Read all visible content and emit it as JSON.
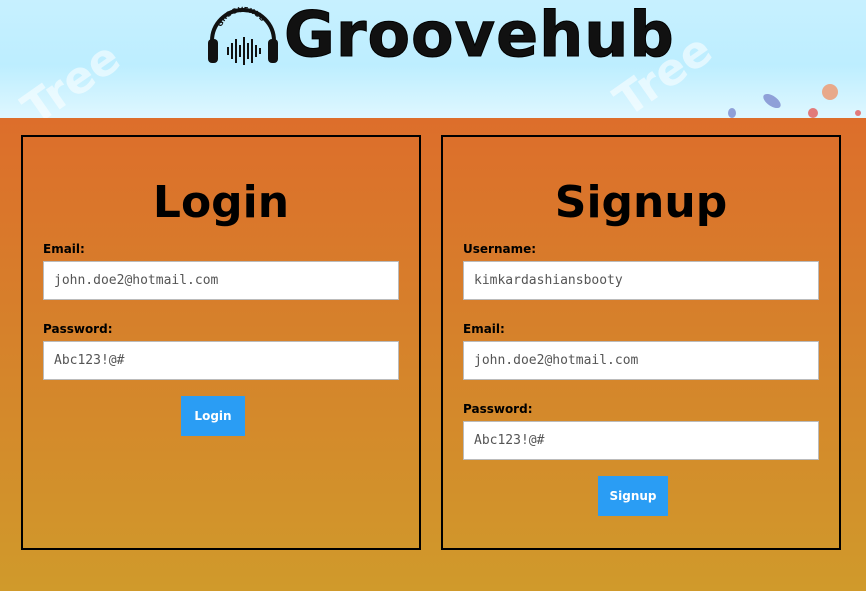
{
  "header": {
    "app_name": "Groovehub",
    "logo_badge_text": "GROOVEHUB",
    "watermark": "Tree"
  },
  "login": {
    "title": "Login",
    "email_label": "Email:",
    "email_value": "john.doe2@hotmail.com",
    "password_label": "Password:",
    "password_value": "Abc123!@#",
    "button_label": "Login"
  },
  "signup": {
    "title": "Signup",
    "username_label": "Username:",
    "username_value": "kimkardashiansbooty",
    "email_label": "Email:",
    "email_value": "john.doe2@hotmail.com",
    "password_label": "Password:",
    "password_value": "Abc123!@#",
    "button_label": "Signup"
  },
  "colors": {
    "accent_button": "#2a9df4",
    "background_top": "#dd6e2b",
    "background_bottom": "#d09a2b",
    "header_bg": "#c7f0ff"
  }
}
